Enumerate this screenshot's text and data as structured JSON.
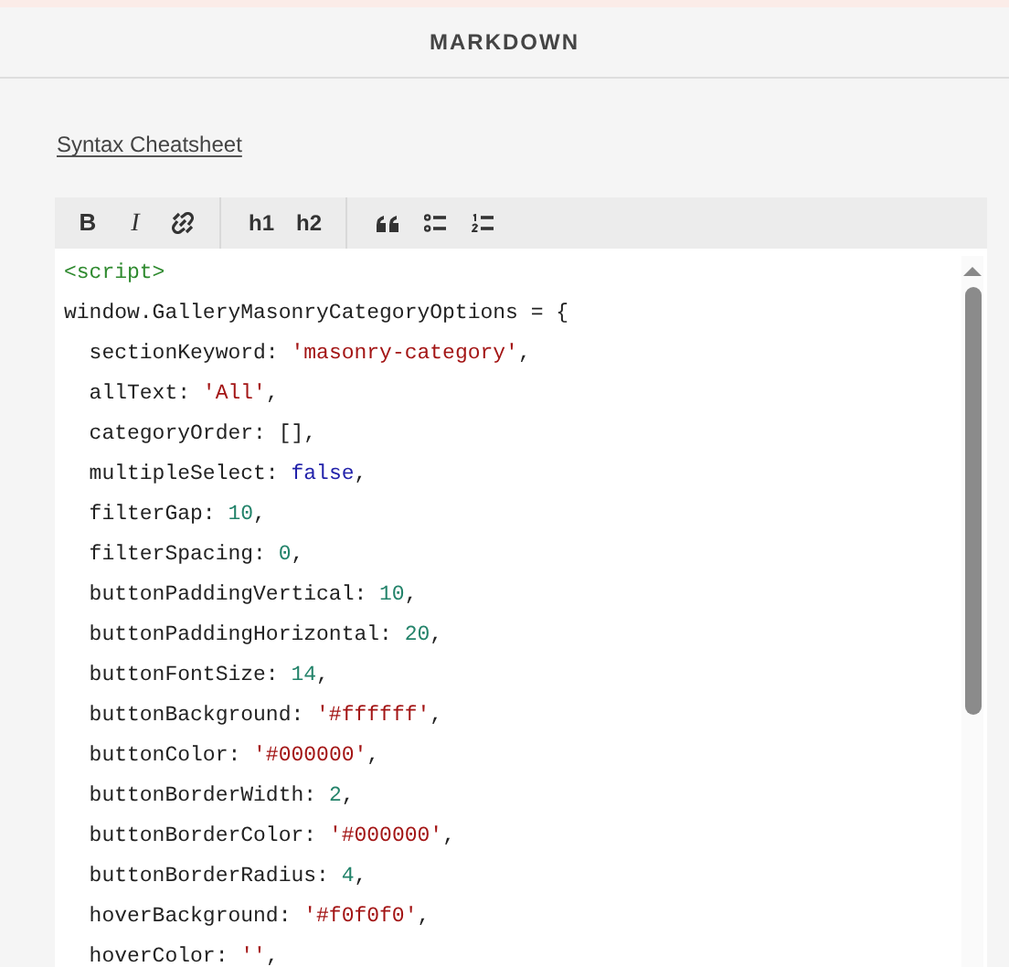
{
  "panel_title": "MARKDOWN",
  "cheatsheet_link": "Syntax Cheatsheet",
  "toolbar": {
    "groups": [
      [
        {
          "kind": "bold",
          "label": "B"
        },
        {
          "kind": "italic",
          "label": "I"
        },
        {
          "kind": "unlink"
        }
      ],
      [
        {
          "kind": "heading",
          "label": "h1"
        },
        {
          "kind": "heading",
          "label": "h2"
        }
      ],
      [
        {
          "kind": "quote"
        },
        {
          "kind": "bullet-list"
        },
        {
          "kind": "numbered-list"
        }
      ]
    ]
  },
  "code_lines": [
    {
      "tokens": [
        {
          "kind": "tag",
          "text": "<script>"
        }
      ]
    },
    {
      "tokens": [
        {
          "kind": "plain",
          "text": "window.GalleryMasonryCategoryOptions = {"
        }
      ]
    },
    {
      "tokens": [
        {
          "kind": "plain",
          "text": "  sectionKeyword: "
        },
        {
          "kind": "string",
          "text": "'masonry-category'"
        },
        {
          "kind": "plain",
          "text": ","
        }
      ]
    },
    {
      "tokens": [
        {
          "kind": "plain",
          "text": "  allText: "
        },
        {
          "kind": "string",
          "text": "'All'"
        },
        {
          "kind": "plain",
          "text": ","
        }
      ]
    },
    {
      "tokens": [
        {
          "kind": "plain",
          "text": "  categoryOrder: [],"
        }
      ]
    },
    {
      "tokens": [
        {
          "kind": "plain",
          "text": "  multipleSelect: "
        },
        {
          "kind": "keyword",
          "text": "false"
        },
        {
          "kind": "plain",
          "text": ","
        }
      ]
    },
    {
      "tokens": [
        {
          "kind": "plain",
          "text": "  filterGap: "
        },
        {
          "kind": "number",
          "text": "10"
        },
        {
          "kind": "plain",
          "text": ","
        }
      ]
    },
    {
      "tokens": [
        {
          "kind": "plain",
          "text": "  filterSpacing: "
        },
        {
          "kind": "number",
          "text": "0"
        },
        {
          "kind": "plain",
          "text": ","
        }
      ]
    },
    {
      "tokens": [
        {
          "kind": "plain",
          "text": "  buttonPaddingVertical: "
        },
        {
          "kind": "number",
          "text": "10"
        },
        {
          "kind": "plain",
          "text": ","
        }
      ]
    },
    {
      "tokens": [
        {
          "kind": "plain",
          "text": "  buttonPaddingHorizontal: "
        },
        {
          "kind": "number",
          "text": "20"
        },
        {
          "kind": "plain",
          "text": ","
        }
      ]
    },
    {
      "tokens": [
        {
          "kind": "plain",
          "text": "  buttonFontSize: "
        },
        {
          "kind": "number",
          "text": "14"
        },
        {
          "kind": "plain",
          "text": ","
        }
      ]
    },
    {
      "tokens": [
        {
          "kind": "plain",
          "text": "  buttonBackground: "
        },
        {
          "kind": "string",
          "text": "'#ffffff'"
        },
        {
          "kind": "plain",
          "text": ","
        }
      ]
    },
    {
      "tokens": [
        {
          "kind": "plain",
          "text": "  buttonColor: "
        },
        {
          "kind": "string",
          "text": "'#000000'"
        },
        {
          "kind": "plain",
          "text": ","
        }
      ]
    },
    {
      "tokens": [
        {
          "kind": "plain",
          "text": "  buttonBorderWidth: "
        },
        {
          "kind": "number",
          "text": "2"
        },
        {
          "kind": "plain",
          "text": ","
        }
      ]
    },
    {
      "tokens": [
        {
          "kind": "plain",
          "text": "  buttonBorderColor: "
        },
        {
          "kind": "string",
          "text": "'#000000'"
        },
        {
          "kind": "plain",
          "text": ","
        }
      ]
    },
    {
      "tokens": [
        {
          "kind": "plain",
          "text": "  buttonBorderRadius: "
        },
        {
          "kind": "number",
          "text": "4"
        },
        {
          "kind": "plain",
          "text": ","
        }
      ]
    },
    {
      "tokens": [
        {
          "kind": "plain",
          "text": "  hoverBackground: "
        },
        {
          "kind": "string",
          "text": "'#f0f0f0'"
        },
        {
          "kind": "plain",
          "text": ","
        }
      ]
    },
    {
      "tokens": [
        {
          "kind": "plain",
          "text": "  hoverColor: "
        },
        {
          "kind": "string",
          "text": "''"
        },
        {
          "kind": "plain",
          "text": ","
        }
      ]
    }
  ]
}
